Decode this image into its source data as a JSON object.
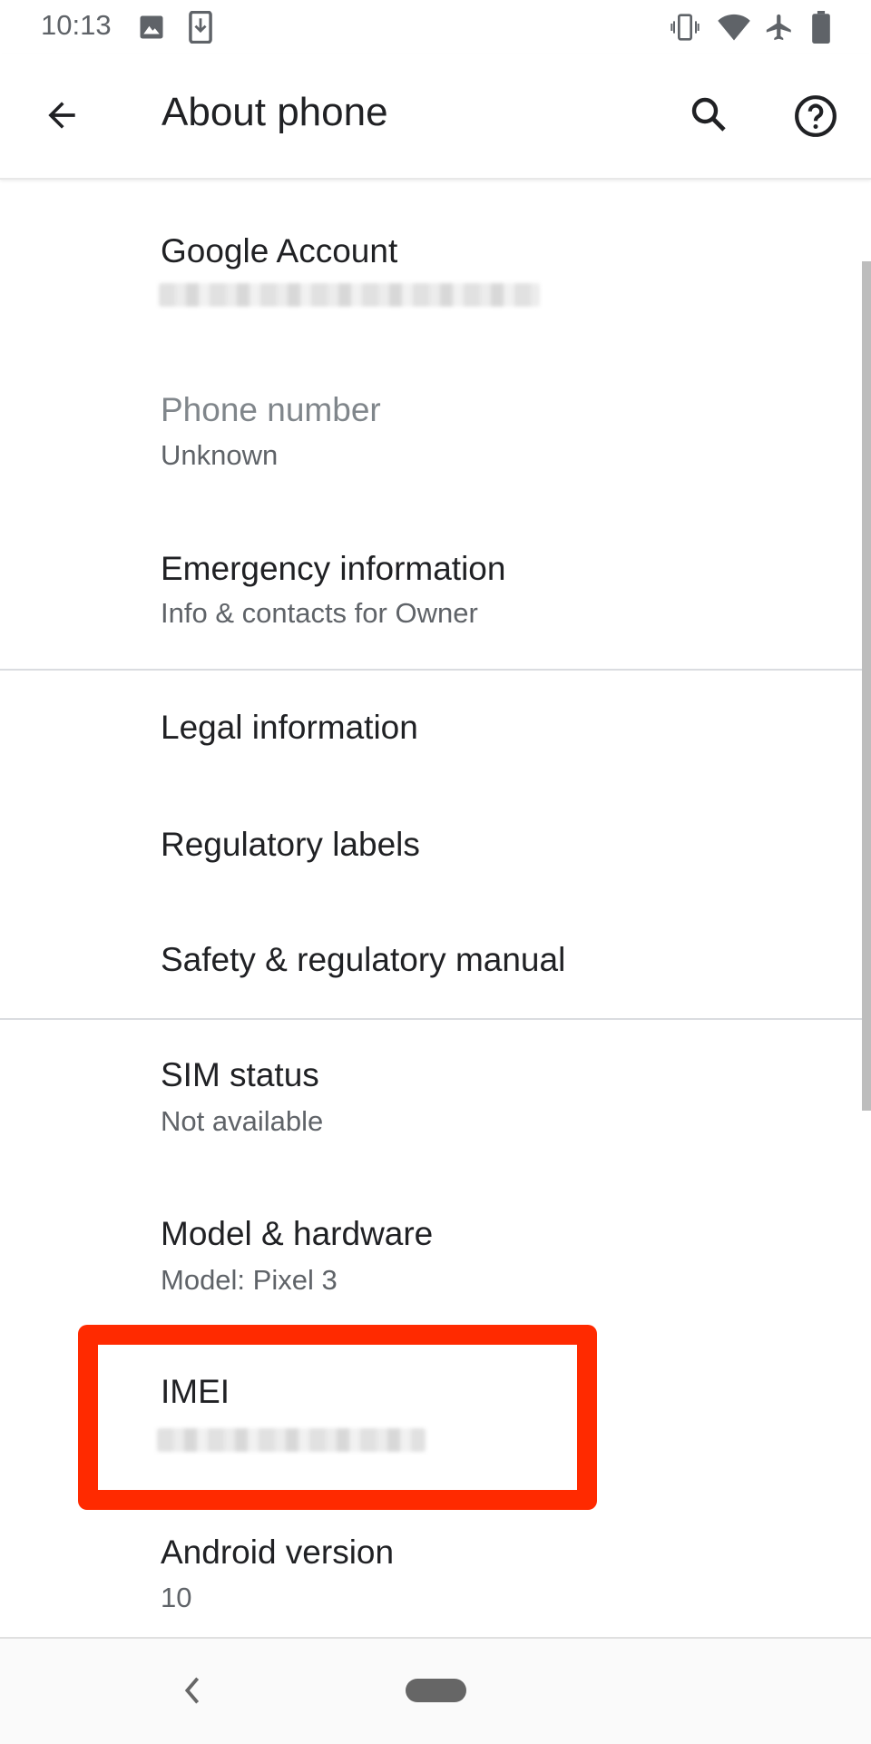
{
  "status_bar": {
    "time": "10:13",
    "left_icons": [
      "image-icon",
      "download-icon"
    ],
    "right_icons": [
      "vibrate-icon",
      "wifi-icon",
      "airplane-icon",
      "battery-icon"
    ]
  },
  "toolbar": {
    "title": "About phone",
    "back_icon": "arrow-back-icon",
    "search_icon": "search-icon",
    "help_icon": "help-icon"
  },
  "items": [
    {
      "title": "Google Account",
      "summary_redacted": true
    },
    {
      "title": "Phone number",
      "summary": "Unknown",
      "disabled": true
    },
    {
      "title": "Emergency information",
      "summary": "Info & contacts for Owner"
    },
    {
      "title": "Legal information"
    },
    {
      "title": "Regulatory labels"
    },
    {
      "title": "Safety & regulatory manual"
    },
    {
      "title": "SIM status",
      "summary": "Not available"
    },
    {
      "title": "Model & hardware",
      "summary": "Model: Pixel 3"
    },
    {
      "title": "IMEI",
      "summary_redacted": true,
      "highlighted": true
    },
    {
      "title": "Android version",
      "summary": "10"
    }
  ],
  "colors": {
    "highlight": "#ff2a00",
    "text_primary": "#202124",
    "text_secondary": "#5f6368"
  },
  "nav_bar": {
    "back_icon": "chevron-left-icon",
    "home_icon": "home-pill-icon"
  }
}
